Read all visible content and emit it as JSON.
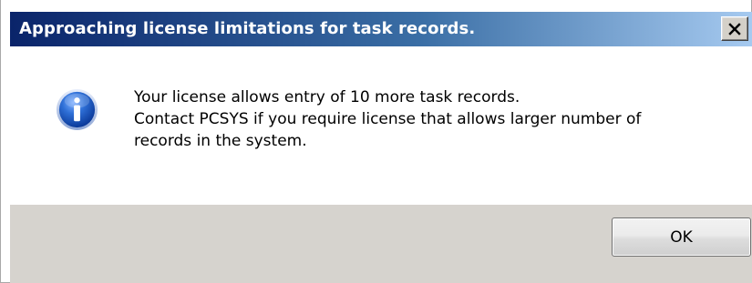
{
  "dialog": {
    "title": "Approaching license limitations for task records.",
    "message_lines": [
      "Your license allows entry of 10 more task records.",
      "Contact PCSYS if you require license that allows larger number of",
      "records in the system."
    ],
    "ok_label": "OK",
    "icon": "info-icon",
    "close_icon": "close-icon"
  }
}
